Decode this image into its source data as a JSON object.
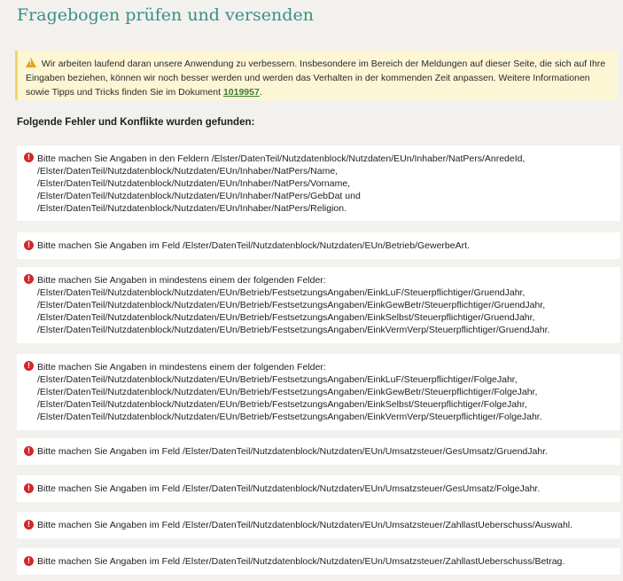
{
  "page": {
    "title": "Fragebogen prüfen und versenden"
  },
  "notice": {
    "icon": "warning-icon",
    "text_before": "Wir arbeiten laufend daran unsere Anwendung zu verbessern. Insbesondere im Bereich der Meldungen auf dieser Seite, die sich auf Ihre Eingaben beziehen, können wir noch besser werden und werden das Verhalten in der kommenden Zeit anpassen. Weitere Informationen sowie Tipps und Tricks finden Sie im Dokument ",
    "link_text": "1019957",
    "text_after": ".",
    "colors": {
      "background": "#fdf6d4",
      "border": "#f2d567",
      "link": "#3a7e33"
    }
  },
  "errors_heading": "Folgende Fehler und Konflikte wurden gefunden:",
  "errors": [
    {
      "lines": [
        "Bitte machen Sie Angaben in den Feldern /Elster/DatenTeil/Nutzdatenblock/Nutzdaten/EUn/Inhaber/NatPers/AnredeId,",
        "/Elster/DatenTeil/Nutzdatenblock/Nutzdaten/EUn/Inhaber/NatPers/Name,",
        "/Elster/DatenTeil/Nutzdatenblock/Nutzdaten/EUn/Inhaber/NatPers/Vorname,",
        "/Elster/DatenTeil/Nutzdatenblock/Nutzdaten/EUn/Inhaber/NatPers/GebDat und",
        "/Elster/DatenTeil/Nutzdatenblock/Nutzdaten/EUn/Inhaber/NatPers/Religion."
      ]
    },
    {
      "lines": [
        "Bitte machen Sie Angaben im Feld /Elster/DatenTeil/Nutzdatenblock/Nutzdaten/EUn/Betrieb/GewerbeArt."
      ]
    },
    {
      "lines": [
        "Bitte machen Sie Angaben in mindestens einem der folgenden Felder:",
        "/Elster/DatenTeil/Nutzdatenblock/Nutzdaten/EUn/Betrieb/FestsetzungsAngaben/EinkLuF/Steuerpflichtiger/GruendJahr,",
        "/Elster/DatenTeil/Nutzdatenblock/Nutzdaten/EUn/Betrieb/FestsetzungsAngaben/EinkGewBetr/Steuerpflichtiger/GruendJahr,",
        "/Elster/DatenTeil/Nutzdatenblock/Nutzdaten/EUn/Betrieb/FestsetzungsAngaben/EinkSelbst/Steuerpflichtiger/GruendJahr,",
        "/Elster/DatenTeil/Nutzdatenblock/Nutzdaten/EUn/Betrieb/FestsetzungsAngaben/EinkVermVerp/Steuerpflichtiger/GruendJahr."
      ]
    },
    {
      "lines": [
        "Bitte machen Sie Angaben in mindestens einem der folgenden Felder:",
        "/Elster/DatenTeil/Nutzdatenblock/Nutzdaten/EUn/Betrieb/FestsetzungsAngaben/EinkLuF/Steuerpflichtiger/FolgeJahr,",
        "/Elster/DatenTeil/Nutzdatenblock/Nutzdaten/EUn/Betrieb/FestsetzungsAngaben/EinkGewBetr/Steuerpflichtiger/FolgeJahr,",
        "/Elster/DatenTeil/Nutzdatenblock/Nutzdaten/EUn/Betrieb/FestsetzungsAngaben/EinkSelbst/Steuerpflichtiger/FolgeJahr,",
        "/Elster/DatenTeil/Nutzdatenblock/Nutzdaten/EUn/Betrieb/FestsetzungsAngaben/EinkVermVerp/Steuerpflichtiger/FolgeJahr."
      ]
    },
    {
      "lines": [
        "Bitte machen Sie Angaben im Feld /Elster/DatenTeil/Nutzdatenblock/Nutzdaten/EUn/Umsatzsteuer/GesUmsatz/GruendJahr."
      ]
    },
    {
      "lines": [
        "Bitte machen Sie Angaben im Feld /Elster/DatenTeil/Nutzdatenblock/Nutzdaten/EUn/Umsatzsteuer/GesUmsatz/FolgeJahr."
      ]
    },
    {
      "lines": [
        "Bitte machen Sie Angaben im Feld /Elster/DatenTeil/Nutzdatenblock/Nutzdaten/EUn/Umsatzsteuer/ZahllastUeberschuss/Auswahl."
      ]
    },
    {
      "lines": [
        "Bitte machen Sie Angaben im Feld /Elster/DatenTeil/Nutzdatenblock/Nutzdaten/EUn/Umsatzsteuer/ZahllastUeberschuss/Betrag."
      ]
    }
  ],
  "error_icon": "error-icon",
  "error_icon_glyph": "!",
  "colors": {
    "page_background": "#f2f1ee",
    "title": "#3b8f86",
    "error_icon": "#d4262a",
    "error_card_background": "#ffffff"
  }
}
